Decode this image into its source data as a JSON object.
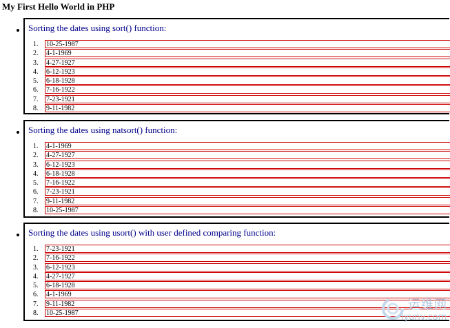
{
  "page_title": "My First Hello World in PHP",
  "sections": [
    {
      "heading": "Sorting the dates using sort() function:",
      "items": [
        {
          "num": "1.",
          "date": "10-25-1987"
        },
        {
          "num": "2.",
          "date": "4-1-1969"
        },
        {
          "num": "3.",
          "date": "4-27-1927"
        },
        {
          "num": "4.",
          "date": "6-12-1923"
        },
        {
          "num": "5.",
          "date": "6-18-1928"
        },
        {
          "num": "6.",
          "date": "7-16-1922"
        },
        {
          "num": "7.",
          "date": "7-23-1921"
        },
        {
          "num": "8.",
          "date": "9-11-1982"
        }
      ]
    },
    {
      "heading": "Sorting the dates using natsort() function:",
      "items": [
        {
          "num": "1.",
          "date": "4-1-1969"
        },
        {
          "num": "2.",
          "date": "4-27-1927"
        },
        {
          "num": "3.",
          "date": "6-12-1923"
        },
        {
          "num": "4.",
          "date": "6-18-1928"
        },
        {
          "num": "5.",
          "date": "7-16-1922"
        },
        {
          "num": "6.",
          "date": "7-23-1921"
        },
        {
          "num": "7.",
          "date": "9-11-1982"
        },
        {
          "num": "8.",
          "date": "10-25-1987"
        }
      ]
    },
    {
      "heading": "Sorting the dates using usort() with user defined comparing function:",
      "items": [
        {
          "num": "1.",
          "date": "7-23-1921"
        },
        {
          "num": "2.",
          "date": "7-16-1922"
        },
        {
          "num": "3.",
          "date": "6-12-1923"
        },
        {
          "num": "4.",
          "date": "4-27-1927"
        },
        {
          "num": "5.",
          "date": "6-18-1928"
        },
        {
          "num": "6.",
          "date": "4-1-1969"
        },
        {
          "num": "7.",
          "date": "9-11-1982"
        },
        {
          "num": "8.",
          "date": "10-25-1987"
        }
      ]
    }
  ],
  "watermark": {
    "text_cn": "运维网",
    "text_en": "iyunv.com",
    "icon": "watermark-logo-icon"
  },
  "colors": {
    "heading": "#00008b",
    "item_border": "#cc0000",
    "section_border": "#000000",
    "watermark": "#b3cce3"
  }
}
